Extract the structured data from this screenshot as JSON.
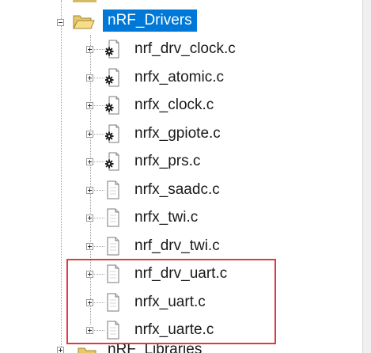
{
  "tree": {
    "folder": {
      "label": "nRF_Drivers",
      "icon": "open-folder-icon",
      "expanded": true,
      "selected": true
    },
    "files": [
      {
        "label": "nrf_drv_clock.c",
        "icon": "c-file-with-gear-icon"
      },
      {
        "label": "nrfx_atomic.c",
        "icon": "c-file-with-gear-icon"
      },
      {
        "label": "nrfx_clock.c",
        "icon": "c-file-with-gear-icon"
      },
      {
        "label": "nrfx_gpiote.c",
        "icon": "c-file-with-gear-icon"
      },
      {
        "label": "nrfx_prs.c",
        "icon": "c-file-with-gear-icon"
      },
      {
        "label": "nrfx_saadc.c",
        "icon": "c-file-icon"
      },
      {
        "label": "nrfx_twi.c",
        "icon": "c-file-icon"
      },
      {
        "label": "nrf_drv_twi.c",
        "icon": "c-file-icon"
      },
      {
        "label": "nrf_drv_uart.c",
        "icon": "c-file-icon"
      },
      {
        "label": "nrfx_uart.c",
        "icon": "c-file-icon"
      },
      {
        "label": "nrfx_uarte.c",
        "icon": "c-file-icon"
      }
    ],
    "next_folder": {
      "label": "nRF_Libraries",
      "icon": "closed-folder-icon"
    }
  },
  "annotation": {
    "color": "#e0393e",
    "target": "uart files highlight"
  },
  "colors": {
    "selection": "#0078d7",
    "text": "#1a1a1a"
  }
}
